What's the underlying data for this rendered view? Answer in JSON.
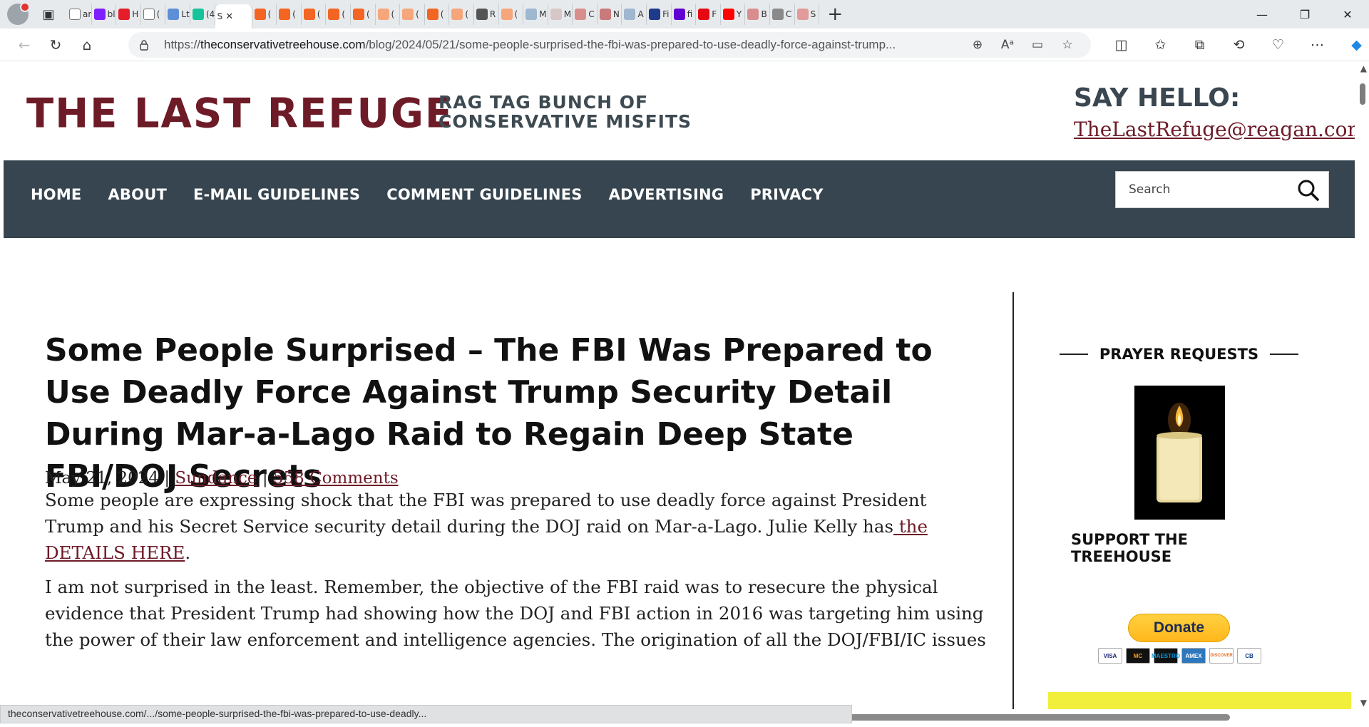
{
  "browser": {
    "active_tab": {
      "title": "S",
      "close": "✕"
    },
    "tabs": [
      {
        "icon": "page-icon",
        "label": "ar",
        "color": "#ffffff"
      },
      {
        "icon": "yahoo-icon",
        "label": "bl",
        "color": "#7e1fff"
      },
      {
        "icon": "news-icon",
        "label": "H",
        "color": "#e41e2b"
      },
      {
        "icon": "page-icon",
        "label": "(",
        "color": "#ffffff"
      },
      {
        "icon": "number-5-icon",
        "label": "Lt",
        "color": "#5d8fd6"
      },
      {
        "icon": "g-icon",
        "label": "(4",
        "color": "#15c39a"
      },
      {
        "icon": "rss-icon",
        "label": "(",
        "color": "#f26522"
      },
      {
        "icon": "rss-icon",
        "label": "(",
        "color": "#f26522"
      },
      {
        "icon": "rss-icon",
        "label": "(",
        "color": "#f26522"
      },
      {
        "icon": "rss-icon",
        "label": "(",
        "color": "#f26522"
      },
      {
        "icon": "rss-icon",
        "label": "(",
        "color": "#f26522"
      },
      {
        "icon": "rss-icon",
        "label": "(",
        "color": "#f5a67a"
      },
      {
        "icon": "rss-icon",
        "label": "(",
        "color": "#f5a67a"
      },
      {
        "icon": "rss-icon",
        "label": "(",
        "color": "#f26522"
      },
      {
        "icon": "rss-icon",
        "label": "(",
        "color": "#f5a67a"
      },
      {
        "icon": "x-icon",
        "label": "R",
        "color": "#555555"
      },
      {
        "icon": "rss-icon",
        "label": "(",
        "color": "#f5a67a"
      },
      {
        "icon": "wordpress-icon",
        "label": "M",
        "color": "#9fb7cf"
      },
      {
        "icon": "bi-icon",
        "label": "M",
        "color": "#d8c7c7"
      },
      {
        "icon": "youtube-icon",
        "label": "C",
        "color": "#d98e8e"
      },
      {
        "icon": "r-icon",
        "label": "N",
        "color": "#c97a7a"
      },
      {
        "icon": "podcast-icon",
        "label": "A",
        "color": "#9fb7cf"
      },
      {
        "icon": "arrow-icon",
        "label": "Fi",
        "color": "#1e3a8a"
      },
      {
        "icon": "yahoo-icon",
        "label": "fi",
        "color": "#6001d2"
      },
      {
        "icon": "netflix-icon",
        "label": "F",
        "color": "#e50914"
      },
      {
        "icon": "youtube-icon",
        "label": "Y",
        "color": "#ff0000"
      },
      {
        "icon": "waves-icon",
        "label": "B",
        "color": "#d98e8e"
      },
      {
        "icon": "b-icon",
        "label": "C",
        "color": "#8a8a8a"
      },
      {
        "icon": "youtube-icon",
        "label": "S",
        "color": "#e39a9a"
      }
    ],
    "url_prefix": "https://",
    "url_host": "theconservativetreehouse.com",
    "url_path": "/blog/2024/05/21/some-people-surprised-the-fbi-was-prepared-to-use-deadly-force-against-trump...",
    "status_url": "theconservativetreehouse.com/.../some-people-surprised-the-fbi-was-prepared-to-use-deadly..."
  },
  "site": {
    "logo": "THE LAST REFUGE",
    "tagline_line1": "RAG TAG BUNCH OF",
    "tagline_line2": "CONSERVATIVE MISFITS",
    "say_hello": "SAY HELLO:",
    "email": "TheLastRefuge@reagan.com",
    "nav": [
      "HOME",
      "ABOUT",
      "E-MAIL GUIDELINES",
      "COMMENT GUIDELINES",
      "ADVERTISING",
      "PRIVACY"
    ],
    "search_placeholder": "Search"
  },
  "article": {
    "title": "Some People Surprised – The FBI Was Prepared to Use Deadly Force Against Trump Security Detail During Mar-a-Lago Raid to Regain Deep State FBI/DOJ Secrets",
    "date": "May 21, 2024",
    "separator": "|",
    "author": "Sundance",
    "comments": "558 Comments",
    "p1_text": "Some people are expressing shock that the FBI was prepared to use deadly force against President Trump and his Secret Service security detail during the DOJ raid on Mar-a-Lago.  Julie Kelly has",
    "p1_link": " the DETAILS HERE",
    "p1_end": ".",
    "p2_text": "I am not surprised in the least.  Remember, the objective of the FBI raid was to resecure the physical evidence that President Trump had showing how the DOJ and FBI action in 2016 was targeting him using the power of their law enforcement and intelligence agencies.   The origination of all the DOJ/FBI/IC issues"
  },
  "sidebar": {
    "prayer_title": "PRAYER REQUESTS",
    "support_title": "SUPPORT THE TREEHOUSE",
    "donate_label": "Donate",
    "cards": [
      "VISA",
      "MC",
      "MAESTRO",
      "AMEX",
      "DISCOVER",
      "CB"
    ]
  },
  "colors": {
    "brand": "#6e1b28",
    "nav_bg": "#36454f",
    "highlight": "#f2ee3c"
  }
}
